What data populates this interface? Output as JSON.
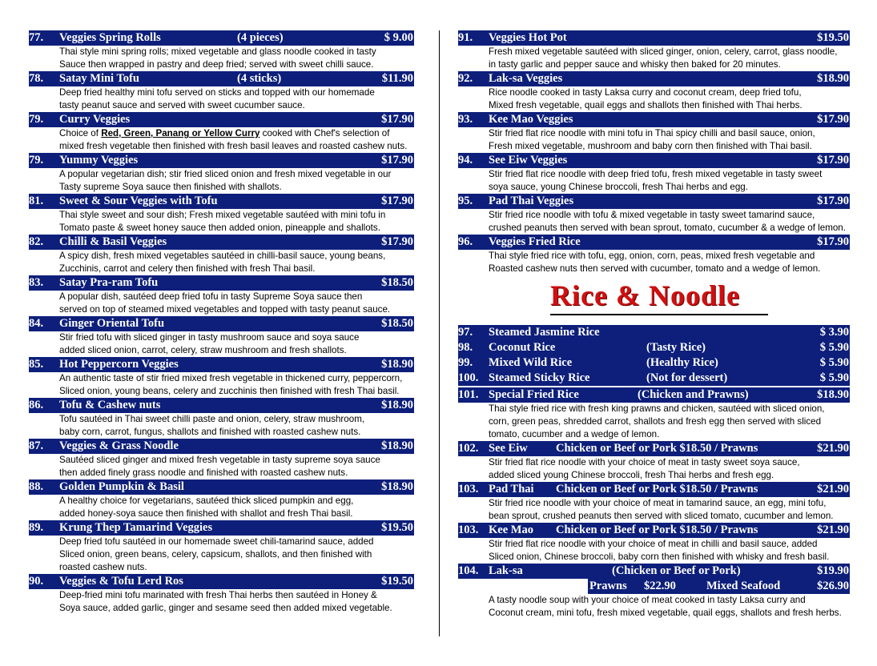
{
  "left": [
    {
      "num": "77.",
      "name": "Veggies Spring Rolls",
      "note": "(4 pieces)",
      "price": "$ 9.00",
      "desc": [
        "Thai style mini spring rolls; mixed vegetable and glass noodle cooked in tasty",
        "Sauce then wrapped in pastry and deep fried; served with sweet chilli sauce."
      ]
    },
    {
      "num": "78.",
      "name": "Satay Mini Tofu",
      "note": "(4 sticks)",
      "price": "$11.90",
      "desc": [
        "Deep fried healthy mini tofu served on sticks and topped with our homemade",
        "tasty peanut sauce and served with sweet cucumber sauce."
      ]
    },
    {
      "num": "79.",
      "name": "Curry Veggies",
      "note": "",
      "price": "$17.90",
      "desc": [
        "__CURRY__",
        "mixed fresh vegetable then finished with fresh basil leaves and roasted cashew nuts."
      ]
    },
    {
      "num": "79.",
      "name": "Yummy Veggies",
      "note": "",
      "price": "$17.90",
      "desc": [
        "A popular vegetarian dish; stir fried sliced onion and fresh mixed vegetable in our",
        "Tasty supreme Soya sauce then finished with shallots."
      ]
    },
    {
      "num": "81.",
      "name": "Sweet & Sour Veggies with Tofu",
      "note": "",
      "price": "$17.90",
      "desc": [
        "Thai style sweet and sour dish; Fresh mixed vegetable sautéed with mini tofu in",
        "Tomato paste & sweet honey sauce then added onion, pineapple and shallots."
      ]
    },
    {
      "num": "82.",
      "name": "Chilli & Basil Veggies",
      "note": "",
      "price": "$17.90",
      "desc": [
        "A spicy dish, fresh mixed vegetables sautéed in chilli-basil sauce, young beans,",
        "Zucchinis, carrot and celery then finished with fresh Thai basil."
      ]
    },
    {
      "num": "83.",
      "name": "Satay Pra-ram Tofu",
      "note": "",
      "price": "$18.50",
      "desc": [
        "A popular dish, sautéed deep fried tofu in tasty Supreme Soya sauce then",
        "served on top of steamed mixed vegetables and topped with tasty peanut sauce."
      ]
    },
    {
      "num": "84.",
      "name": "Ginger Oriental Tofu",
      "note": "",
      "price": "$18.50",
      "desc": [
        "Stir fried tofu with sliced ginger in tasty mushroom sauce and soya sauce",
        "added sliced onion, carrot, celery, straw mushroom and fresh shallots."
      ]
    },
    {
      "num": "85.",
      "name": "Hot Peppercorn Veggies",
      "note": "",
      "price": "$18.90",
      "desc": [
        "An authentic taste of stir fried mixed fresh vegetable in thickened curry, peppercorn,",
        "Sliced onion, young beans, celery and zucchinis then finished with fresh Thai basil."
      ]
    },
    {
      "num": "86.",
      "name": "Tofu & Cashew nuts",
      "note": "",
      "price": "$18.90",
      "desc": [
        "Tofu sautéed in Thai sweet chilli paste and onion, celery, straw mushroom,",
        "baby corn, carrot, fungus, shallots and finished with roasted cashew nuts."
      ]
    },
    {
      "num": "87.",
      "name": "Veggies & Grass Noodle",
      "note": "",
      "price": "$18.90",
      "desc": [
        "Sautéed sliced ginger and mixed fresh vegetable in tasty supreme soya sauce",
        "then added finely grass noodle and finished with roasted cashew nuts."
      ]
    },
    {
      "num": "88.",
      "name": "Golden Pumpkin & Basil",
      "note": "",
      "price": "$18.90",
      "desc": [
        "A healthy choice for vegetarians, sautéed thick sliced pumpkin and egg,",
        "added honey-soya sauce then finished with shallot and fresh Thai basil."
      ]
    },
    {
      "num": "89.",
      "name": "Krung Thep Tamarind Veggies",
      "note": "",
      "price": "$19.50",
      "desc": [
        "Deep fried tofu sautéed in our homemade sweet chili-tamarind sauce, added",
        "Sliced onion, green beans, celery, capsicum, shallots, and then finished with",
        "roasted cashew nuts."
      ]
    },
    {
      "num": "90.",
      "name": "Veggies & Tofu Lerd Ros",
      "note": "",
      "price": "$19.50",
      "desc": [
        "Deep-fried mini tofu marinated with fresh Thai herbs then sautéed in Honey &",
        "Soya sauce, added garlic, ginger and sesame seed then added mixed vegetable."
      ]
    }
  ],
  "curry_line": {
    "pre": "Choice of ",
    "choices": "Red, Green, Panang or Yellow Curry",
    "post": " cooked with Chef's selection of"
  },
  "right": [
    {
      "num": "91.",
      "name": "Veggies Hot Pot",
      "price": "$19.50",
      "desc": [
        "Fresh mixed vegetable sautéed with sliced ginger, onion, celery, carrot, glass noodle,",
        "in tasty garlic and pepper sauce and whisky then baked for 20 minutes."
      ]
    },
    {
      "num": "92.",
      "name": "Lak-sa Veggies",
      "price": "$18.90",
      "desc": [
        "Rice noodle cooked in tasty Laksa curry and coconut cream, deep fried tofu,",
        "Mixed fresh vegetable, quail eggs and shallots then finished with Thai herbs."
      ]
    },
    {
      "num": "93.",
      "name": "Kee Mao Veggies",
      "price": "$17.90",
      "desc": [
        "Stir fried flat rice noodle with mini tofu in Thai spicy chilli and basil sauce, onion,",
        "Fresh mixed vegetable, mushroom and baby corn then finished with Thai basil."
      ]
    },
    {
      "num": "94.",
      "name": "See Eiw Veggies",
      "price": "$17.90",
      "desc": [
        "Stir fried flat rice noodle with deep fried tofu, fresh mixed vegetable in tasty sweet",
        "soya sauce, young Chinese broccoli, fresh Thai herbs and egg."
      ]
    },
    {
      "num": "95.",
      "name": "Pad Thai Veggies",
      "price": "$17.90",
      "desc": [
        "Stir fried rice noodle with tofu & mixed vegetable in tasty sweet tamarind sauce,",
        "crushed peanuts then served with bean sprout, tomato, cucumber & a wedge of lemon."
      ]
    },
    {
      "num": "96.",
      "name": "Veggies Fried Rice",
      "price": "$17.90",
      "desc": [
        "Thai style fried rice with tofu, egg, onion, corn, peas, mixed fresh vegetable and",
        "Roasted cashew nuts then served with cucumber, tomato and a wedge of lemon."
      ]
    }
  ],
  "section_title": "Rice & Noodle",
  "rice": [
    {
      "num": "97.",
      "name": "Steamed Jasmine Rice",
      "note": "",
      "price": "$ 3.90"
    },
    {
      "num": "98.",
      "name": "Coconut Rice",
      "note": "(Tasty Rice)",
      "price": "$ 5.90"
    },
    {
      "num": "99.",
      "name": "Mixed Wild Rice",
      "note": "(Healthy Rice)",
      "price": "$ 5.90"
    },
    {
      "num": "100.",
      "name": "Steamed Sticky Rice",
      "note": "(Not for dessert)",
      "price": "$ 5.90"
    }
  ],
  "noodles": [
    {
      "num": "101.",
      "name": "Special Fried Rice",
      "note": "(Chicken and Prawns)",
      "price": "$18.90",
      "desc": [
        "Thai style fried rice with fresh king prawns and chicken, sautéed with sliced onion,",
        "corn, green peas, shredded carrot, shallots and fresh egg then served with sliced",
        "tomato, cucumber and a wedge of lemon."
      ]
    },
    {
      "num": "102.",
      "name": "See Eiw",
      "note": "Chicken or Beef or Pork  $18.50 / Prawns",
      "price": "$21.90",
      "desc": [
        "Stir fried flat rice noodle with your choice of meat in tasty sweet soya sauce,",
        "added sliced young Chinese broccoli, fresh Thai herbs and fresh egg."
      ]
    },
    {
      "num": "103.",
      "name": "Pad Thai",
      "note": "Chicken or Beef or Pork  $18.50 / Prawns",
      "price": "$21.90",
      "desc": [
        "Stir fried rice noodle with your choice of meat in tamarind sauce, an egg, mini tofu,",
        "bean sprout, crushed peanuts then served with sliced tomato, cucumber and lemon."
      ]
    },
    {
      "num": "103.",
      "name": "Kee Mao",
      "note": "Chicken or Beef or Pork  $18.50 / Prawns",
      "price": "$21.90",
      "desc": [
        "Stir fried flat rice noodle with your choice of meat in chilli and basil sauce,  added",
        "Sliced onion, Chinese broccoli, baby corn then finished with whisky and fresh basil."
      ]
    }
  ],
  "laksa": {
    "num": "104.",
    "name": "Lak-sa",
    "note": "(Chicken or Beef or Pork)",
    "price": "$19.90",
    "prawns_label": "Prawns",
    "prawns_price": "$22.90",
    "seafood_label": "Mixed Seafood",
    "seafood_price": "$26.90",
    "desc": [
      "A tasty noodle soup with your choice of meat cooked in tasty Laksa curry and",
      "Coconut cream, mini tofu, fresh mixed vegetable, quail eggs, shallots and fresh herbs."
    ]
  }
}
